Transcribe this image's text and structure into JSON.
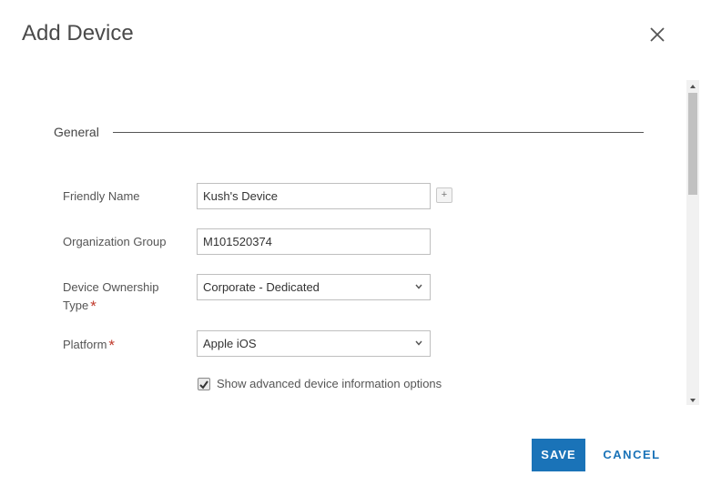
{
  "dialog": {
    "title": "Add Device"
  },
  "general": {
    "section_title": "General",
    "friendly_name": {
      "label": "Friendly Name",
      "value": "Kush's Device"
    },
    "organization_group": {
      "label": "Organization Group",
      "value": "M101520374"
    },
    "device_ownership": {
      "label_line1": "Device Ownership",
      "label_line2": "Type",
      "required": "*",
      "selected": "Corporate - Dedicated"
    },
    "platform": {
      "label": "Platform",
      "required": "*",
      "selected": "Apple iOS"
    },
    "advanced_option": {
      "label": "Show advanced device information options",
      "checked": true
    },
    "add_lookup": "+"
  },
  "footer": {
    "save_label": "SAVE",
    "cancel_label": "CANCEL"
  },
  "colors": {
    "accent": "#1a73b8",
    "required": "#c0392b"
  },
  "icons": {
    "close": "close-icon",
    "chevron": "chevron-down-icon",
    "check": "checkmark-icon"
  }
}
